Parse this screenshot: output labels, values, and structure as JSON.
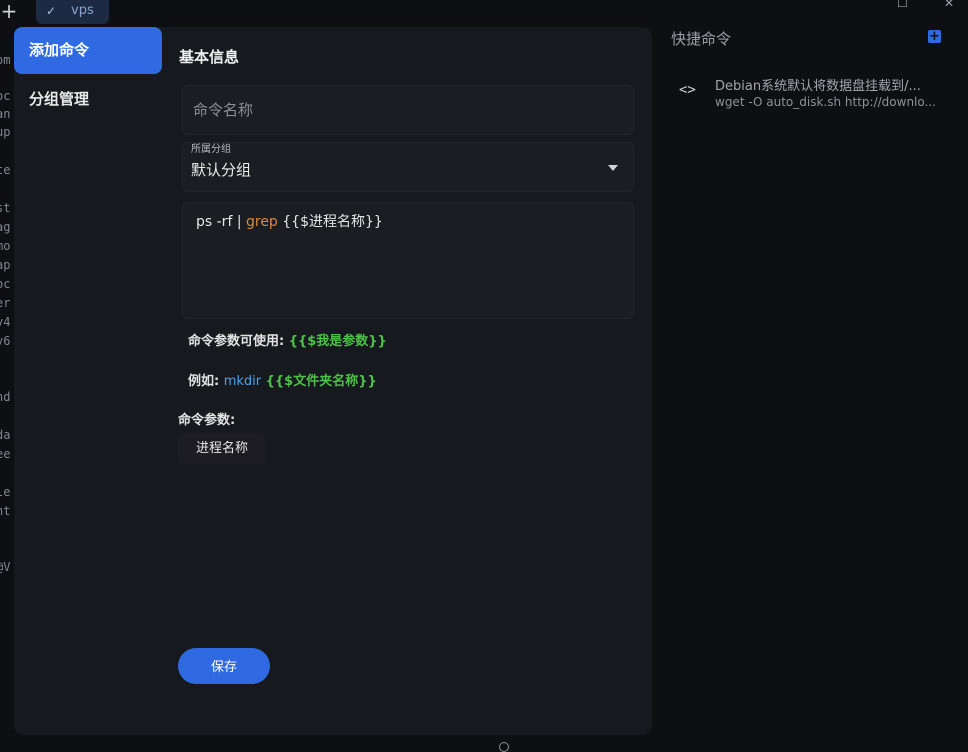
{
  "app": {
    "new_tab_icon": "plus-icon",
    "tab": {
      "label": "vps",
      "icon": "check-icon"
    }
  },
  "terminal_fragments": [
    "om",
    "oc",
    "an",
    "up",
    "te",
    "st",
    "ag",
    "mo",
    "ap",
    "oc",
    "er",
    "v4",
    "v6",
    "nd",
    "da",
    "ee",
    "le",
    "nt",
    "@V"
  ],
  "sidebar": {
    "items": [
      {
        "label": "添加命令",
        "active": true
      },
      {
        "label": "分组管理",
        "active": false
      }
    ]
  },
  "form": {
    "section_title": "基本信息",
    "name_placeholder": "命令名称",
    "group_label": "所属分组",
    "group_value": "默认分组",
    "command": {
      "part1": "ps -rf | ",
      "keyword": "grep",
      "part2": " {{$进程名称}}"
    },
    "hint_params": {
      "text": "命令参数可使用: ",
      "example": "{{$我是参数}}"
    },
    "hint_example": {
      "text": "例如: ",
      "cmd": "mkdir",
      "param": " {{$文件夹名称}}"
    },
    "params_label": "命令参数:",
    "params": [
      "进程名称"
    ],
    "save_label": "保存"
  },
  "quick_commands": {
    "title": "快捷命令",
    "items": [
      {
        "title": "Debian系统默认将数据盘挂载到/...",
        "cmd": "wget -O auto_disk.sh http://downlo..."
      }
    ]
  },
  "colors": {
    "accent": "#2f6ae3",
    "green": "#4fc04a",
    "keyword": "#d98a3d",
    "blue": "#4aa3f0"
  }
}
